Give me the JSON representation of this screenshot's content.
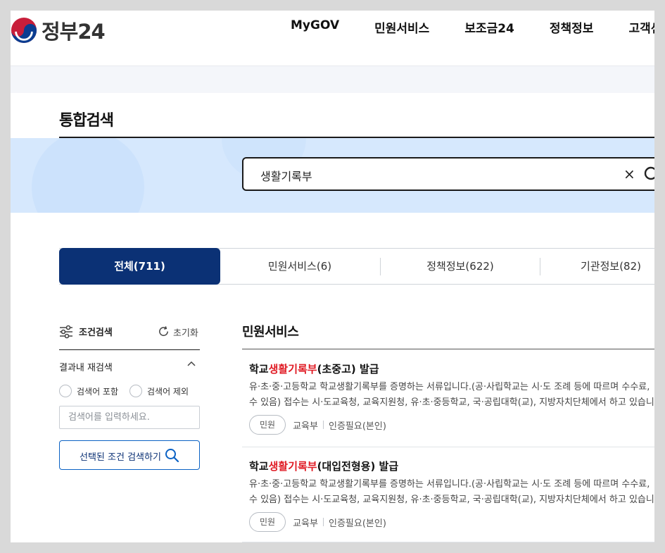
{
  "header": {
    "logo_text": "정부24",
    "nav": [
      "MyGOV",
      "민원서비스",
      "보조금24",
      "정책정보",
      "고객센터"
    ]
  },
  "page_title": "통합검색",
  "search": {
    "value": "생활기록부",
    "clear_symbol": "×"
  },
  "tabs": [
    {
      "label": "전체(711)",
      "active": true
    },
    {
      "label": "민원서비스(6)",
      "active": false
    },
    {
      "label": "정책정보(622)",
      "active": false
    },
    {
      "label": "기관정보(82)",
      "active": false
    }
  ],
  "filter": {
    "title": "조건검색",
    "reset": "초기화",
    "refine_title": "결과내 재검색",
    "include_label": "검색어 포함",
    "exclude_label": "검색어 제외",
    "input_placeholder": "검색어를 입력하세요.",
    "submit_label": "선택된 조건 검색하기"
  },
  "results_section": {
    "title": "민원서비스",
    "items": [
      {
        "title_prefix": "학교",
        "title_highlight": "생활기록부",
        "title_suffix": "(초중고) 발급",
        "desc_line1": "유·초·중·고등학교 학교생활기록부를 증명하는 서류입니다.(공·사립학교는 시·도 조례 등에 따르며 수수료,",
        "desc_line2": "수 있음) 접수는 시·도교육청, 교육지원청, 유·초·중등학교, 국·공립대학(교), 지방자치단체에서 하고 있습니",
        "tag": "민원",
        "org": "교육부",
        "auth": "인증필요(본인)"
      },
      {
        "title_prefix": "학교",
        "title_highlight": "생활기록부",
        "title_suffix": "(대입전형용) 발급",
        "desc_line1": "유·초·중·고등학교 학교생활기록부를 증명하는 서류입니다.(공·사립학교는 시·도 조례 등에 따르며 수수료,",
        "desc_line2": "수 있음) 접수는 시·도교육청, 교육지원청, 유·초·중등학교, 국·공립대학(교), 지방자치단체에서 하고 있습니",
        "tag": "민원",
        "org": "교육부",
        "auth": "인증필요(본인)"
      }
    ]
  },
  "colors": {
    "accent_navy": "#0b3175",
    "highlight_red": "#e01b24",
    "hero_bg": "#d6e8fd",
    "button_border": "#0b62c4"
  },
  "icons": {
    "logo": "taegeuk-logo-icon",
    "search": "search-icon",
    "clear": "close-icon",
    "filter": "sliders-icon",
    "reset": "refresh-icon",
    "chevron": "chevron-up-icon"
  }
}
